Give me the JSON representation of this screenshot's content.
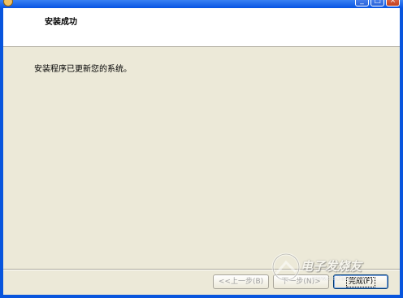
{
  "window": {
    "title": "",
    "controls": {
      "minimize": "_",
      "maximize": "□",
      "close": "×"
    }
  },
  "header": {
    "title": "安装成功"
  },
  "body": {
    "message": "安装程序已更新您的系统。"
  },
  "buttons": {
    "back": "<<上一步(B)",
    "next": "下一步(N)>",
    "finish": "完成(F)"
  },
  "watermark": {
    "brand": "电子发烧友",
    "url": "www.elecfans.com"
  },
  "colors": {
    "titlebar": "#0854e3",
    "face": "#ece9d8",
    "header_bg": "#ffffff",
    "close_button": "#c2401f"
  }
}
